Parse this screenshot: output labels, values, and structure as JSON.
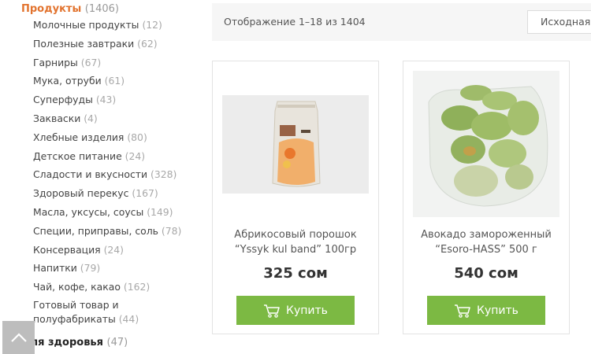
{
  "sidebar": {
    "root": {
      "label": "Продукты",
      "count": "(1406)"
    },
    "items": [
      {
        "label": "Молочные продукты",
        "count": "(12)"
      },
      {
        "label": "Полезные завтраки",
        "count": "(62)"
      },
      {
        "label": "Гарниры",
        "count": "(67)"
      },
      {
        "label": "Мука, отруби",
        "count": "(61)"
      },
      {
        "label": "Суперфуды",
        "count": "(43)"
      },
      {
        "label": "Закваски",
        "count": "(4)"
      },
      {
        "label": "Хлебные изделия",
        "count": "(80)"
      },
      {
        "label": "Детское питание",
        "count": "(24)"
      },
      {
        "label": "Сладости и вкусности",
        "count": "(328)"
      },
      {
        "label": "Здоровый перекус",
        "count": "(167)"
      },
      {
        "label": "Масла, уксусы, соусы",
        "count": "(149)"
      },
      {
        "label": "Специи, приправы, соль",
        "count": "(78)"
      },
      {
        "label": "Консервация",
        "count": "(24)"
      },
      {
        "label": "Напитки",
        "count": "(79)"
      },
      {
        "label": "Чай, кофе, какао",
        "count": "(162)"
      },
      {
        "label": "Готовый товар и полуфабрикаты",
        "count": "(44)"
      }
    ],
    "root2": {
      "label": "Для здоровья",
      "count": "(47)"
    }
  },
  "toolbar": {
    "result_count": "Отображение 1–18 из 1404",
    "sort_value": "Исходная"
  },
  "products": [
    {
      "name": "Абрикосовый порошок “Yssyk kul band” 100гр",
      "price": "325 сом",
      "button": "Купить"
    },
    {
      "name": "Авокадо замороженный “Esoro-HASS” 500 г",
      "price": "540 сом",
      "button": "Купить"
    }
  ],
  "colors": {
    "accent": "#e2732e",
    "button": "#7cb943"
  }
}
